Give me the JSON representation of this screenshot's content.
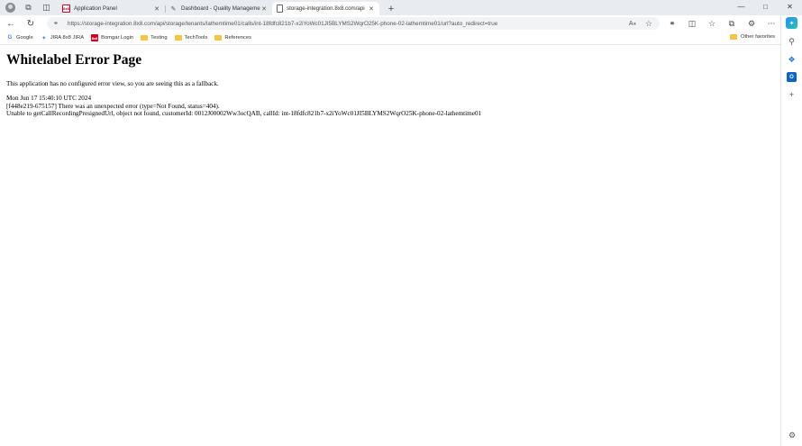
{
  "browser": {
    "tabs": [
      {
        "title": "Application Panel",
        "favicon": "8x8-logo"
      },
      {
        "title": "Dashboard - Quality Manageme",
        "favicon": "pen-icon"
      },
      {
        "title": "storage-integration.8x8.com/api",
        "favicon": "doc-icon"
      }
    ],
    "url": "https://storage-integration.8x8.com/api/storage/tenants/lathemtime01/calls/int-18fdfc821b7-x2iYoWc01JI5BLYMS2WqrO25K-phone-02-lathemtime01/url?auto_redirect=true",
    "favorites": [
      {
        "label": "Google",
        "icon": "google-icon"
      },
      {
        "label": "JIRA 8x8 JIRA",
        "icon": "jira-icon"
      },
      {
        "label": "Bomgar Login",
        "icon": "bomgar-icon"
      },
      {
        "label": "Testing",
        "icon": "folder-icon"
      },
      {
        "label": "TechTools",
        "icon": "folder-icon"
      },
      {
        "label": "References",
        "icon": "folder-icon"
      }
    ],
    "other_favorites": "Other favorites"
  },
  "page": {
    "heading": "Whitelabel Error Page",
    "intro": "This application has no configured error view, so you are seeing this as a fallback.",
    "timestamp": "Mon Jun 17 15:40:10 UTC 2024",
    "error_line": "[f448e219-675157] There was an unexpected error (type=Not Found, status=404).",
    "detail_line": "Unable to getCallRecordingPresignedUrl, object not found, customerId: 0012J00002Ww3ocQAB, callId: int-18fdfc821b7-x2iYoWc01JI5BLYMS2WqrO25K-phone-02-lathemtime01"
  }
}
